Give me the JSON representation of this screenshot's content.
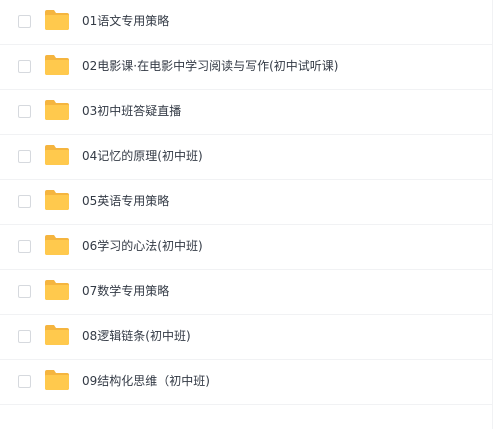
{
  "folder_icon": "folder-icon",
  "folder_color": "#ffc94d",
  "folder_tab_color": "#f5b53f",
  "files": [
    {
      "name": "01语文专用策略"
    },
    {
      "name": "02电影课·在电影中学习阅读与写作(初中试听课)"
    },
    {
      "name": "03初中班答疑直播"
    },
    {
      "name": "04记忆的原理(初中班)"
    },
    {
      "name": "05英语专用策略"
    },
    {
      "name": "06学习的心法(初中班)"
    },
    {
      "name": "07数学专用策略"
    },
    {
      "name": "08逻辑链条(初中班)"
    },
    {
      "name": "09结构化思维（初中班)"
    }
  ]
}
